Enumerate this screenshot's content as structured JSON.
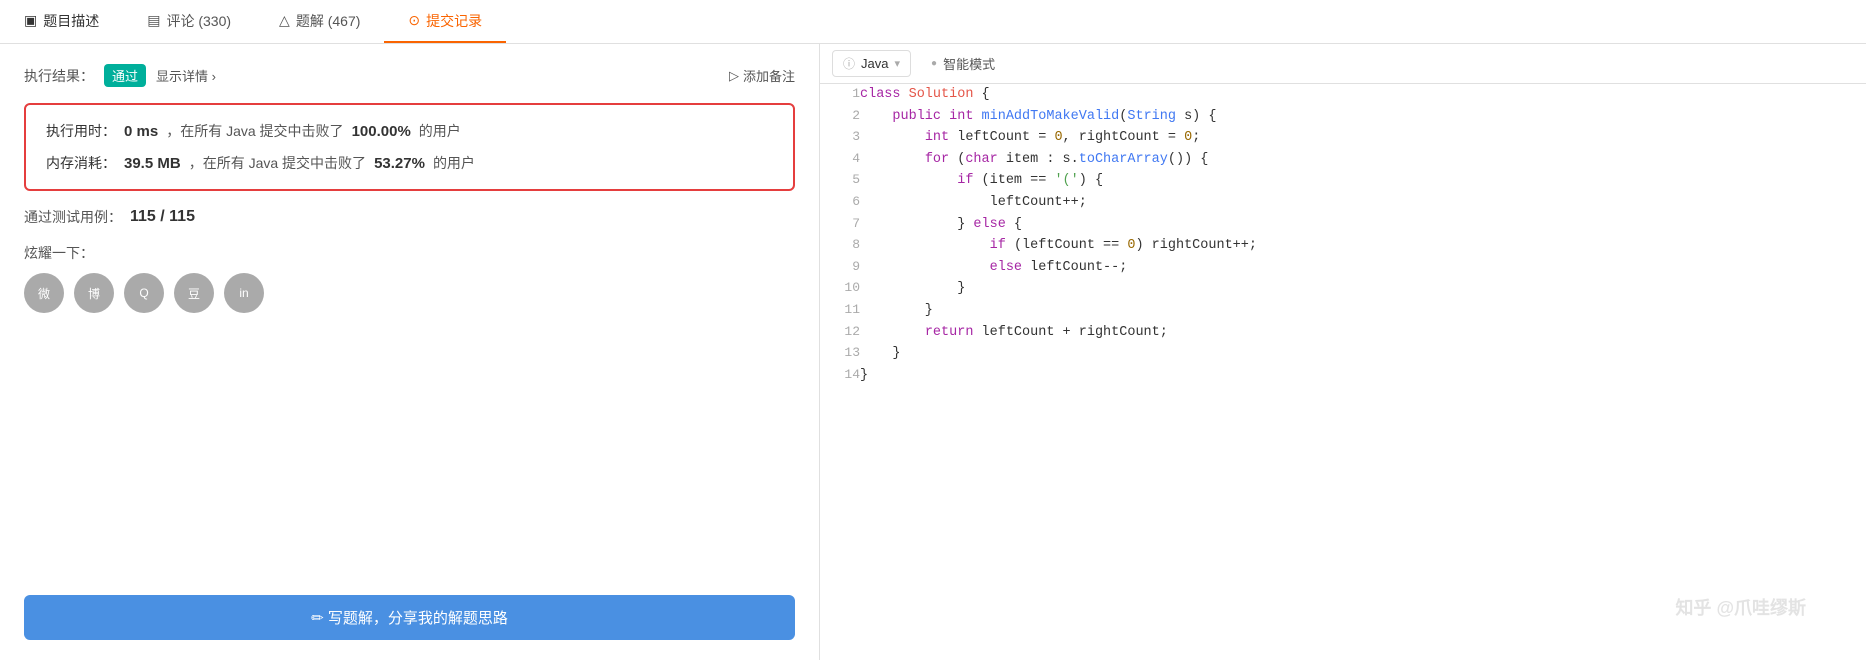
{
  "tabs": [
    {
      "id": "description",
      "icon": "📋",
      "label": "题目描述",
      "active": false
    },
    {
      "id": "comments",
      "icon": "💬",
      "label": "评论 (330)",
      "active": false
    },
    {
      "id": "solutions",
      "icon": "🧪",
      "label": "题解 (467)",
      "active": false
    },
    {
      "id": "submissions",
      "icon": "🕐",
      "label": "提交记录",
      "active": true
    }
  ],
  "toolbar": {
    "language": "Java",
    "language_icon": "ℹ",
    "chevron": "▾",
    "dot_color": "#aaa",
    "smart_mode_dot": "●",
    "smart_mode_label": "智能模式"
  },
  "result": {
    "exec_label": "执行结果：",
    "pass_badge": "通过",
    "detail_link": "显示详情 ›",
    "add_note": "添加备注",
    "add_note_icon": "▷"
  },
  "stats": {
    "time_label": "执行用时：",
    "time_value": "0 ms",
    "time_text1": "，在所有 Java 提交中击败了",
    "time_percent": "100.00%",
    "time_text2": "的用户",
    "memory_label": "内存消耗：",
    "memory_value": "39.5 MB",
    "memory_text1": "，在所有 Java 提交中击败了",
    "memory_percent": "53.27%",
    "memory_text2": "的用户"
  },
  "test_cases": {
    "label": "通过测试用例：",
    "value": "115 / 115"
  },
  "share": {
    "label": "炫耀一下：",
    "icons": [
      {
        "id": "wechat",
        "symbol": "微"
      },
      {
        "id": "weibo",
        "symbol": "博"
      },
      {
        "id": "qq",
        "symbol": "Q"
      },
      {
        "id": "douban",
        "symbol": "豆"
      },
      {
        "id": "linkedin",
        "symbol": "in"
      }
    ]
  },
  "write_solution_btn": "✏ 写题解，分享我的解题思路",
  "code": {
    "lines": [
      {
        "num": 1,
        "tokens": [
          {
            "t": "kw",
            "v": "class "
          },
          {
            "t": "cn",
            "v": "Solution"
          },
          {
            "t": "punct",
            "v": " {"
          }
        ]
      },
      {
        "num": 2,
        "tokens": [
          {
            "t": "",
            "v": "    "
          },
          {
            "t": "kw",
            "v": "public "
          },
          {
            "t": "kw",
            "v": "int "
          },
          {
            "t": "fn",
            "v": "minAddToMakeValid"
          },
          {
            "t": "punct",
            "v": "("
          },
          {
            "t": "type",
            "v": "String"
          },
          {
            "t": "",
            "v": " s) {"
          }
        ]
      },
      {
        "num": 3,
        "tokens": [
          {
            "t": "",
            "v": "        "
          },
          {
            "t": "kw",
            "v": "int "
          },
          {
            "t": "",
            "v": "leftCount = "
          },
          {
            "t": "num",
            "v": "0"
          },
          {
            "t": "",
            "v": ", rightCount = "
          },
          {
            "t": "num",
            "v": "0"
          },
          {
            "t": "",
            "v": ";"
          }
        ]
      },
      {
        "num": 4,
        "tokens": [
          {
            "t": "",
            "v": "        "
          },
          {
            "t": "kw",
            "v": "for "
          },
          {
            "t": "",
            "v": "("
          },
          {
            "t": "kw",
            "v": "char"
          },
          {
            "t": "",
            "v": " item : s."
          },
          {
            "t": "fn",
            "v": "toCharArray"
          },
          {
            "t": "",
            "v": "()) {"
          }
        ]
      },
      {
        "num": 5,
        "tokens": [
          {
            "t": "",
            "v": "            "
          },
          {
            "t": "kw",
            "v": "if "
          },
          {
            "t": "",
            "v": "(item == "
          },
          {
            "t": "str",
            "v": "'('"
          },
          {
            "t": "",
            "v": ") {"
          }
        ]
      },
      {
        "num": 6,
        "tokens": [
          {
            "t": "",
            "v": "                leftCount++;"
          }
        ]
      },
      {
        "num": 7,
        "tokens": [
          {
            "t": "",
            "v": "            } "
          },
          {
            "t": "kw",
            "v": "else"
          },
          {
            "t": "",
            "v": " {"
          }
        ]
      },
      {
        "num": 8,
        "tokens": [
          {
            "t": "",
            "v": "                "
          },
          {
            "t": "kw",
            "v": "if "
          },
          {
            "t": "",
            "v": "(leftCount == "
          },
          {
            "t": "num",
            "v": "0"
          },
          {
            "t": "",
            "v": ") rightCount++;"
          }
        ]
      },
      {
        "num": 9,
        "tokens": [
          {
            "t": "",
            "v": "                "
          },
          {
            "t": "kw",
            "v": "else"
          },
          {
            "t": "",
            "v": " leftCount--;"
          }
        ]
      },
      {
        "num": 10,
        "tokens": [
          {
            "t": "",
            "v": "            }"
          }
        ]
      },
      {
        "num": 11,
        "tokens": [
          {
            "t": "",
            "v": "        }"
          }
        ]
      },
      {
        "num": 12,
        "tokens": [
          {
            "t": "",
            "v": "        "
          },
          {
            "t": "kw",
            "v": "return"
          },
          {
            "t": "",
            "v": " leftCount + rightCount;"
          }
        ]
      },
      {
        "num": 13,
        "tokens": [
          {
            "t": "",
            "v": "    }"
          }
        ]
      },
      {
        "num": 14,
        "tokens": [
          {
            "t": "",
            "v": "}"
          }
        ]
      }
    ]
  },
  "watermark": "知乎 @爪哇缪斯"
}
